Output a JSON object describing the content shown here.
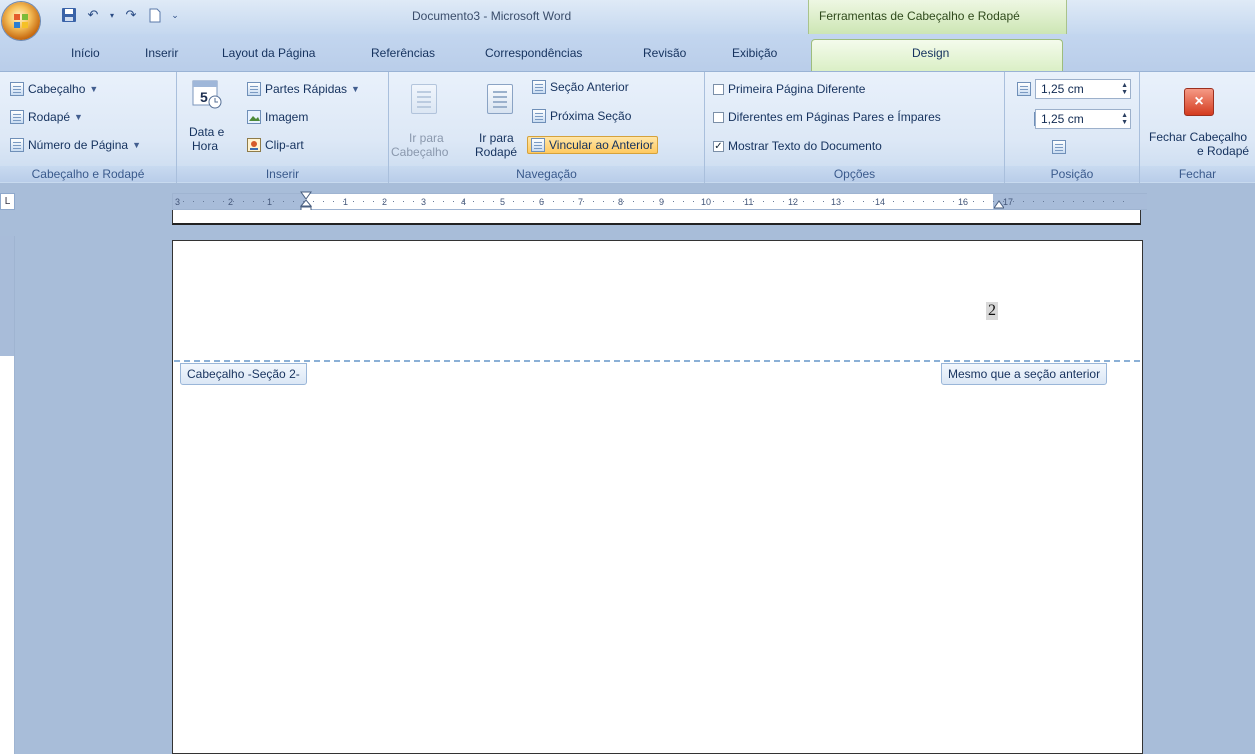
{
  "window": {
    "title": "Documento3 - Microsoft Word",
    "context_title": "Ferramentas de Cabeçalho e Rodapé"
  },
  "tabs": [
    "Início",
    "Inserir",
    "Layout da Página",
    "Referências",
    "Correspondências",
    "Revisão",
    "Exibição",
    "Design"
  ],
  "active_tab": "Design",
  "ribbon": {
    "header_footer": {
      "label": "Cabeçalho e Rodapé",
      "cabecalho": "Cabeçalho",
      "rodape": "Rodapé",
      "numero_pagina": "Número de Página"
    },
    "inserir": {
      "label": "Inserir",
      "data_hora_1": "Data e",
      "data_hora_2": "Hora",
      "partes_rapidas": "Partes Rápidas",
      "imagem": "Imagem",
      "clip_art": "Clip-art",
      "calendar_number": "5"
    },
    "navegacao": {
      "label": "Navegação",
      "ir_cabecalho_1": "Ir para",
      "ir_cabecalho_2": "Cabeçalho",
      "ir_rodape_1": "Ir para",
      "ir_rodape_2": "Rodapé",
      "secao_anterior": "Seção Anterior",
      "proxima_secao": "Próxima Seção",
      "vincular_anterior": "Vincular ao Anterior"
    },
    "opcoes": {
      "label": "Opções",
      "primeira_pagina": "Primeira Página Diferente",
      "paginas_pares": "Diferentes em Páginas Pares e Ímpares",
      "mostrar_texto": "Mostrar Texto do Documento",
      "primeira_pagina_checked": false,
      "paginas_pares_checked": false,
      "mostrar_texto_checked": true
    },
    "posicao": {
      "label": "Posição",
      "header_from_top": "1,25 cm",
      "footer_from_bottom": "1,25 cm"
    },
    "fechar": {
      "label": "Fechar",
      "button_1": "Fechar Cabeçalho",
      "button_2": "e Rodapé"
    }
  },
  "ruler": {
    "corner_symbol": "L",
    "labels": [
      "3",
      "2",
      "1",
      "1",
      "2",
      "3",
      "4",
      "5",
      "6",
      "7",
      "8",
      "9",
      "10",
      "11",
      "12",
      "13",
      "14",
      "16",
      "17"
    ]
  },
  "document": {
    "page_number": "2",
    "header_tag": "Cabeçalho -Seção 2-",
    "link_tag": "Mesmo que a seção anterior"
  },
  "colors": {
    "accent": "#15325e",
    "context_tab": "#d8eec2",
    "close_button": "#d43b1f",
    "highlight": "#ffc960"
  }
}
